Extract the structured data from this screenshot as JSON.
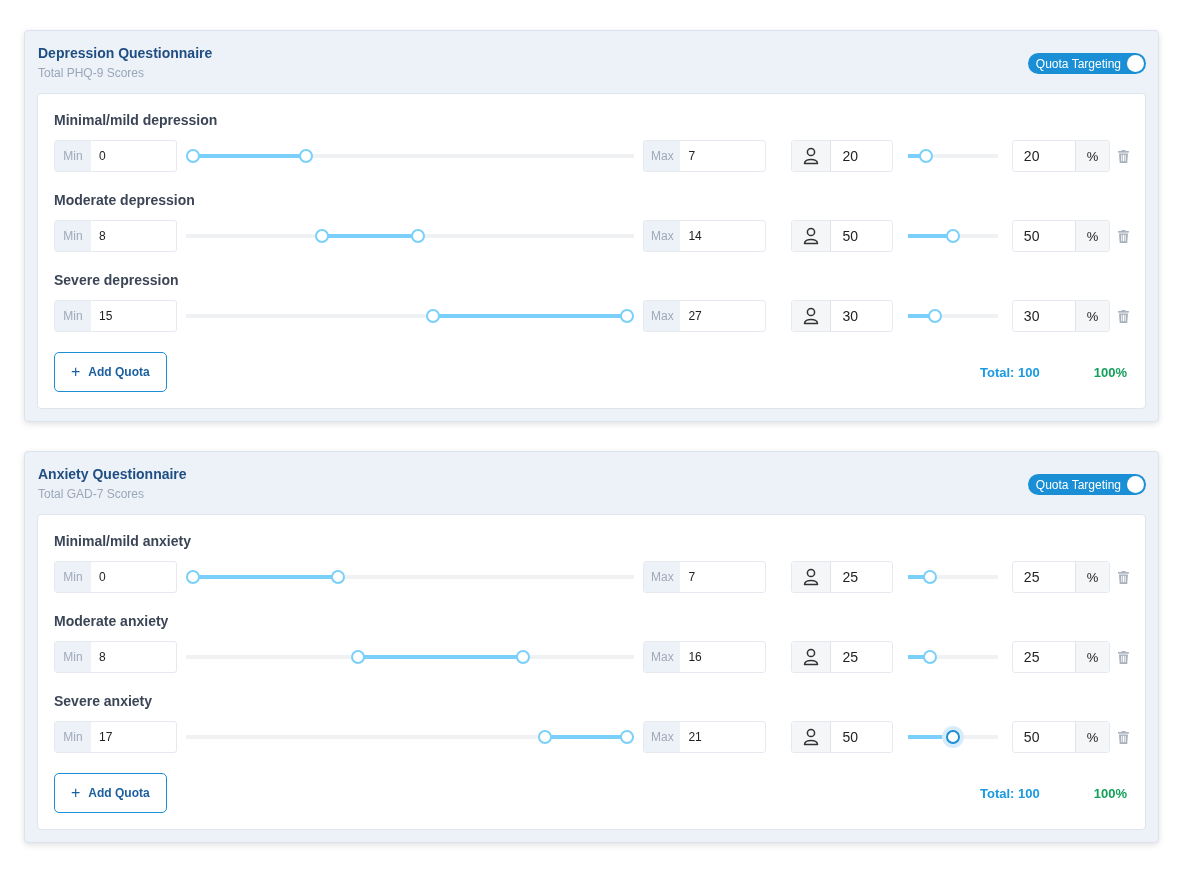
{
  "questionnaires": [
    {
      "title": "Depression Questionnaire",
      "subtitle": "Total PHQ-9 Scores",
      "quota_targeting": {
        "label": "Quota Targeting",
        "on": true
      },
      "quotas": [
        {
          "label": "Minimal/mild depression",
          "min_label": "Min",
          "min": "0",
          "range": {
            "low": {
              "level": 0
            },
            "high": {
              "level": 0.26
            }
          },
          "max_label": "Max",
          "max": "7",
          "count": "20",
          "share": {
            "level": 0.2,
            "focused": false
          },
          "percent": "20",
          "unit": "%"
        },
        {
          "label": "Moderate depression",
          "min_label": "Min",
          "min": "8",
          "range": {
            "low": {
              "level": 0.296
            },
            "high": {
              "level": 0.518
            }
          },
          "max_label": "Max",
          "max": "14",
          "count": "50",
          "share": {
            "level": 0.5,
            "focused": false
          },
          "percent": "50",
          "unit": "%"
        },
        {
          "label": "Severe depression",
          "min_label": "Min",
          "min": "15",
          "range": {
            "low": {
              "level": 0.552
            },
            "high": {
              "level": 1
            }
          },
          "max_label": "Max",
          "max": "27",
          "count": "30",
          "share": {
            "level": 0.3,
            "focused": false
          },
          "percent": "30",
          "unit": "%"
        }
      ],
      "add_button": {
        "icon": "+",
        "label": "Add Quota"
      },
      "total": "Total: 100",
      "total_percent": "100%"
    },
    {
      "title": "Anxiety Questionnaire",
      "subtitle": "Total GAD-7 Scores",
      "quota_targeting": {
        "label": "Quota Targeting",
        "on": true
      },
      "quotas": [
        {
          "label": "Minimal/mild anxiety",
          "min_label": "Min",
          "min": "0",
          "range": {
            "low": {
              "level": 0
            },
            "high": {
              "level": 0.333
            }
          },
          "max_label": "Max",
          "max": "7",
          "count": "25",
          "share": {
            "level": 0.25,
            "focused": false
          },
          "percent": "25",
          "unit": "%"
        },
        {
          "label": "Moderate anxiety",
          "min_label": "Min",
          "min": "8",
          "range": {
            "low": {
              "level": 0.38
            },
            "high": {
              "level": 0.76
            }
          },
          "max_label": "Max",
          "max": "16",
          "count": "25",
          "share": {
            "level": 0.25,
            "focused": false
          },
          "percent": "25",
          "unit": "%"
        },
        {
          "label": "Severe anxiety",
          "min_label": "Min",
          "min": "17",
          "range": {
            "low": {
              "level": 0.81
            },
            "high": {
              "level": 1
            }
          },
          "max_label": "Max",
          "max": "21",
          "count": "50",
          "share": {
            "level": 0.5,
            "focused": true
          },
          "percent": "50",
          "unit": "%"
        }
      ],
      "add_button": {
        "icon": "+",
        "label": "Add Quota"
      },
      "total": "Total: 100",
      "total_percent": "100%"
    }
  ]
}
